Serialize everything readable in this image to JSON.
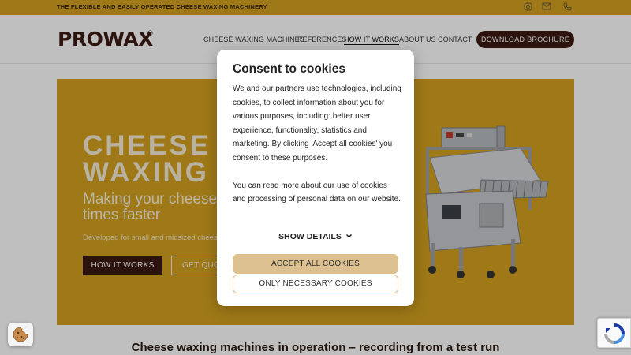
{
  "topbar": {
    "tagline": "THE FLEXIBLE AND EASILY OPERATED CHEESE WAXING MACHINERY",
    "icons": [
      "instagram-icon",
      "mail-icon",
      "phone-icon"
    ]
  },
  "header": {
    "logo_text": "PROWAX",
    "logo_mark": "®",
    "nav": [
      {
        "label": "CHEESE WAXING MACHINES"
      },
      {
        "label": "REFERENCES"
      },
      {
        "label": "HOW IT WORKS"
      },
      {
        "label": "ABOUT US"
      },
      {
        "label": "CONTACT"
      }
    ],
    "active_nav": "HOW IT WORKS",
    "brochure_label": "DOWNLOAD BROCHURE"
  },
  "hero": {
    "title_line1": "CHEESE",
    "title_line2": "WAXING",
    "subtitle_line1": "Making your cheese",
    "subtitle_line2": "times faster",
    "small_text": "Developed for small and midsized chees",
    "how_button": "HOW IT WORKS",
    "quote_button": "GET QUO"
  },
  "page_heading": "Cheese waxing machines in operation – recording from a test run",
  "cookie_modal": {
    "title": "Consent to cookies",
    "paragraph1": "We and our partners use technologies, including cookies, to collect information about you for various purposes, including: better user experience, functionality, statistics and marketing. By clicking 'Accept all cookies' you consent to these purposes.",
    "paragraph2": "You can read more about our use of cookies and processing of personal data on our website.",
    "show_details": "SHOW DETAILS",
    "accept_all": "ACCEPT ALL COOKIES",
    "only_necessary": "ONLY NECESSARY COOKIES"
  },
  "colors": {
    "brand_gold": "#d4a21f",
    "brand_brown": "#3d1a12",
    "accept_beige": "#dcc08f"
  }
}
